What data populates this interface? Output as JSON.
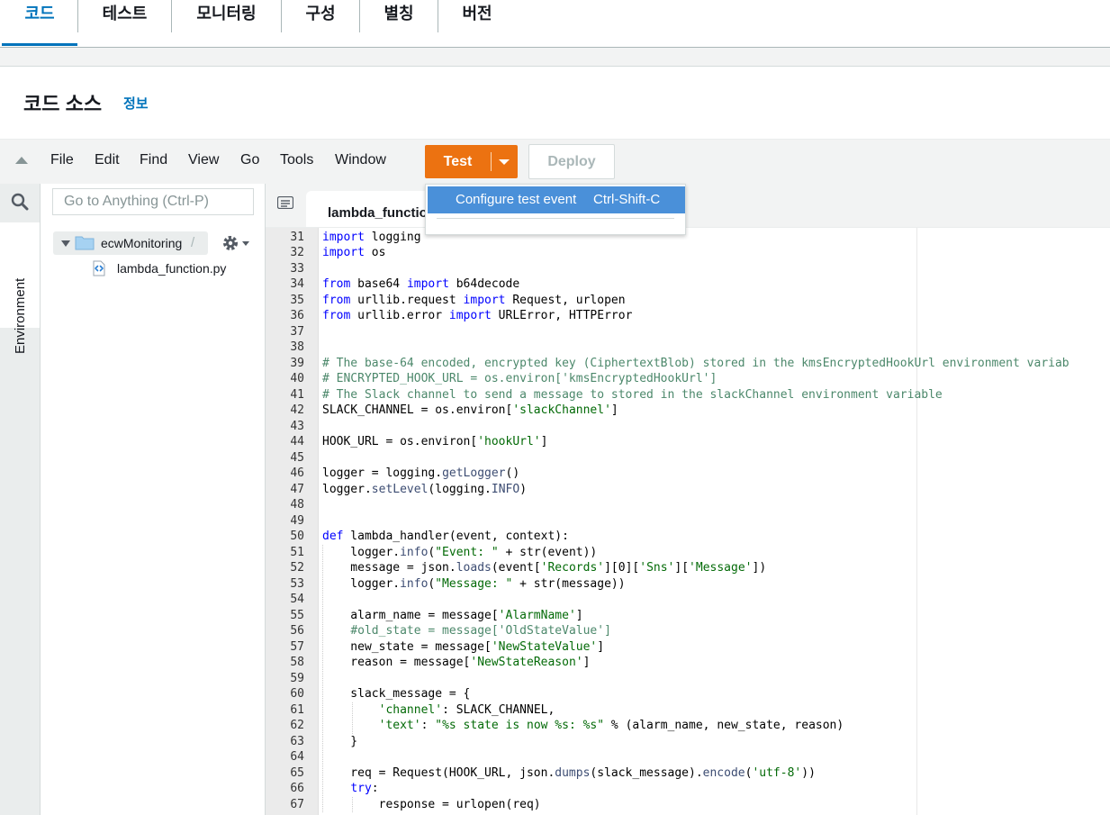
{
  "tabs": [
    {
      "label": "코드",
      "active": true
    },
    {
      "label": "테스트"
    },
    {
      "label": "모니터링"
    },
    {
      "label": "구성"
    },
    {
      "label": "별칭"
    },
    {
      "label": "버전"
    }
  ],
  "header": {
    "title": "코드 소스",
    "info": "정보"
  },
  "menu": [
    "File",
    "Edit",
    "Find",
    "View",
    "Go",
    "Tools",
    "Window"
  ],
  "toolbar": {
    "test_label": "Test",
    "deploy_label": "Deploy"
  },
  "dropdown": {
    "item_label": "Configure test event",
    "item_shortcut": "Ctrl-Shift-C"
  },
  "sidebar": {
    "goto_placeholder": "Go to Anything (Ctrl-P)",
    "env_label": "Environment"
  },
  "tree": {
    "root": "ecwMonitoring",
    "root_suffix": "/",
    "file": "lambda_function.py"
  },
  "editor": {
    "tab_label": "lambda_function.py"
  },
  "colors": {
    "accent": "#0073bb",
    "test_button": "#ec7211",
    "menu_highlight": "#4a90d9"
  },
  "code": {
    "lines": [
      {
        "n": "31",
        "text": "import logging"
      },
      {
        "n": "32",
        "text": "import os"
      },
      {
        "n": "33",
        "text": ""
      },
      {
        "n": "34",
        "text": "from base64 import b64decode"
      },
      {
        "n": "35",
        "text": "from urllib.request import Request, urlopen"
      },
      {
        "n": "36",
        "text": "from urllib.error import URLError, HTTPError"
      },
      {
        "n": "37",
        "text": ""
      },
      {
        "n": "38",
        "text": ""
      },
      {
        "n": "39",
        "text": "# The base-64 encoded, encrypted key (CiphertextBlob) stored in the kmsEncryptedHookUrl environment variab"
      },
      {
        "n": "40",
        "text": "# ENCRYPTED_HOOK_URL = os.environ['kmsEncryptedHookUrl']"
      },
      {
        "n": "41",
        "text": "# The Slack channel to send a message to stored in the slackChannel environment variable"
      },
      {
        "n": "42",
        "text": "SLACK_CHANNEL = os.environ['slackChannel']"
      },
      {
        "n": "43",
        "text": ""
      },
      {
        "n": "44",
        "text": "HOOK_URL = os.environ['hookUrl']"
      },
      {
        "n": "45",
        "text": ""
      },
      {
        "n": "46",
        "text": "logger = logging.getLogger()"
      },
      {
        "n": "47",
        "text": "logger.setLevel(logging.INFO)"
      },
      {
        "n": "48",
        "text": ""
      },
      {
        "n": "49",
        "text": ""
      },
      {
        "n": "50",
        "text": "def lambda_handler(event, context):"
      },
      {
        "n": "51",
        "text": "    logger.info(\"Event: \" + str(event))"
      },
      {
        "n": "52",
        "text": "    message = json.loads(event['Records'][0]['Sns']['Message'])"
      },
      {
        "n": "53",
        "text": "    logger.info(\"Message: \" + str(message))"
      },
      {
        "n": "54",
        "text": ""
      },
      {
        "n": "55",
        "text": "    alarm_name = message['AlarmName']"
      },
      {
        "n": "56",
        "text": "    #old_state = message['OldStateValue']"
      },
      {
        "n": "57",
        "text": "    new_state = message['NewStateValue']"
      },
      {
        "n": "58",
        "text": "    reason = message['NewStateReason']"
      },
      {
        "n": "59",
        "text": ""
      },
      {
        "n": "60",
        "text": "    slack_message = {"
      },
      {
        "n": "61",
        "text": "        'channel': SLACK_CHANNEL,"
      },
      {
        "n": "62",
        "text": "        'text': \"%s state is now %s: %s\" % (alarm_name, new_state, reason)"
      },
      {
        "n": "63",
        "text": "    }"
      },
      {
        "n": "64",
        "text": ""
      },
      {
        "n": "65",
        "text": "    req = Request(HOOK_URL, json.dumps(slack_message).encode('utf-8'))"
      },
      {
        "n": "66",
        "text": "    try:"
      },
      {
        "n": "67",
        "text": "        response = urlopen(req)"
      }
    ]
  }
}
